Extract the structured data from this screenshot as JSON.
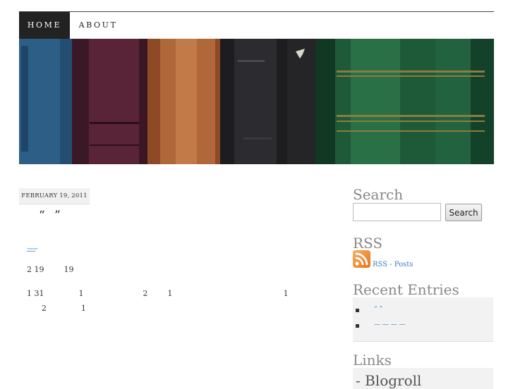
{
  "nav": {
    "items": [
      {
        "label": "HOME",
        "active": true
      },
      {
        "label": "ABOUT",
        "active": false
      }
    ]
  },
  "post": {
    "date": "FEBRUARY 19, 2011",
    "title": "“ ”",
    "meta": "—",
    "lines": [
      "2 19        19",
      "1 31              1                        2        1                                             1",
      "      2              1"
    ]
  },
  "sidebar": {
    "search": {
      "title": "Search",
      "button": "Search",
      "placeholder": ""
    },
    "rss": {
      "title": "RSS",
      "link": "RSS - Posts"
    },
    "recent": {
      "title": "Recent Entries",
      "items": [
        "“ ”",
        "— — — —"
      ]
    },
    "links": {
      "title": "Links",
      "blogroll": "- Blogroll"
    }
  },
  "colors": {
    "nav_active_bg": "#222222",
    "link": "#3b7cc0",
    "sidebar_title": "#888888"
  }
}
